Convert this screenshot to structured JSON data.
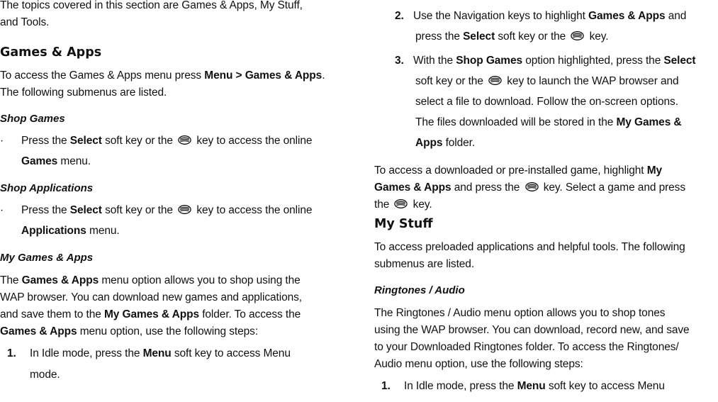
{
  "left": {
    "intro_l1": "The topics covered in this section are Games & Apps, My Stuff,",
    "intro_l2": "and Tools.",
    "h_games": "Games & Apps",
    "access_l1_pre": "To access the Games & Apps menu press ",
    "access_l1_bold": "Menu > Games & Apps",
    "access_l1_post": ".",
    "access_l2": "The following submenus are listed.",
    "h_shop_games": "Shop Games",
    "sg_l1_pre": "Press the ",
    "sg_l1_bold": "Select",
    "sg_l1_mid": " soft key or the ",
    "sg_l1_post": " key to access the online",
    "sg_l2_bold": "Games",
    "sg_l2_post": " menu.",
    "h_shop_apps": "Shop Applications",
    "sa_l1_pre": "Press the ",
    "sa_l1_bold": "Select",
    "sa_l1_mid": " soft key or the ",
    "sa_l1_post": " key to access the online",
    "sa_l2_bold": "Applications",
    "sa_l2_post": " menu.",
    "h_my_games": "My Games & Apps",
    "mg_l1_pre": "The ",
    "mg_l1_bold": "Games & Apps",
    "mg_l1_post": " menu option allows you to shop using the",
    "mg_l2": "WAP browser. You can download new games and applications,",
    "mg_l3_pre": "and save them to the ",
    "mg_l3_bold": "My Games & Apps",
    "mg_l3_post": " folder. To access the",
    "mg_l4_bold": "Games & Apps",
    "mg_l4_post": " menu option, use the following steps:",
    "step1_num": "1.",
    "step1_l1_pre": "In Idle mode, press the ",
    "step1_l1_bold": "Menu",
    "step1_l1_post": " soft key to access Menu",
    "step1_l2": "mode."
  },
  "right": {
    "step2_num": "2.",
    "step2_l1_pre": "Use the Navigation keys to highlight ",
    "step2_l1_bold": "Games & Apps",
    "step2_l1_post": " and",
    "step2_l2_pre": "press the ",
    "step2_l2_bold": "Select",
    "step2_l2_mid": " soft key or the ",
    "step2_l2_post": " key.",
    "step3_num": "3.",
    "step3_l1_pre": "With the ",
    "step3_l1_bold": "Shop Games",
    "step3_l1_mid": " option highlighted, press the ",
    "step3_l1_bold2": "Select",
    "step3_l2_pre": "soft key or the ",
    "step3_l2_post": " key to launch the WAP browser and",
    "step3_l3": "select a file to download. Follow the on-screen options.",
    "step3_l4_pre": "The files downloaded will be stored in the ",
    "step3_l4_bold": "My Games &",
    "step3_l5_bold": "Apps",
    "step3_l5_post": " folder.",
    "dl_l1_pre": "To access a downloaded or pre-installed game, highlight ",
    "dl_l1_bold": "My",
    "dl_l2_bold": "Games & Apps",
    "dl_l2_mid": " and press the ",
    "dl_l2_post": " key. Select a game and press",
    "dl_l3_pre": "the ",
    "dl_l3_post": " key.",
    "h_my_stuff": "My Stuff",
    "ms_l1": "To access preloaded applications and helpful tools. The following",
    "ms_l2": "submenus are listed.",
    "h_ringtones": "Ringtones / Audio",
    "rt_l1": "The Ringtones / Audio menu option allows you to shop tones",
    "rt_l2": "using the WAP browser. You can download, record new, and save",
    "rt_l3": "to your Downloaded Ringtones folder. To access the Ringtones/",
    "rt_l4": "Audio menu option, use the following steps:",
    "rstep1_num": "1.",
    "rstep1_pre": "In Idle mode, press the ",
    "rstep1_bold": "Menu",
    "rstep1_post": " soft key to access Menu"
  },
  "icons": {
    "select_key": "select-key-icon"
  }
}
